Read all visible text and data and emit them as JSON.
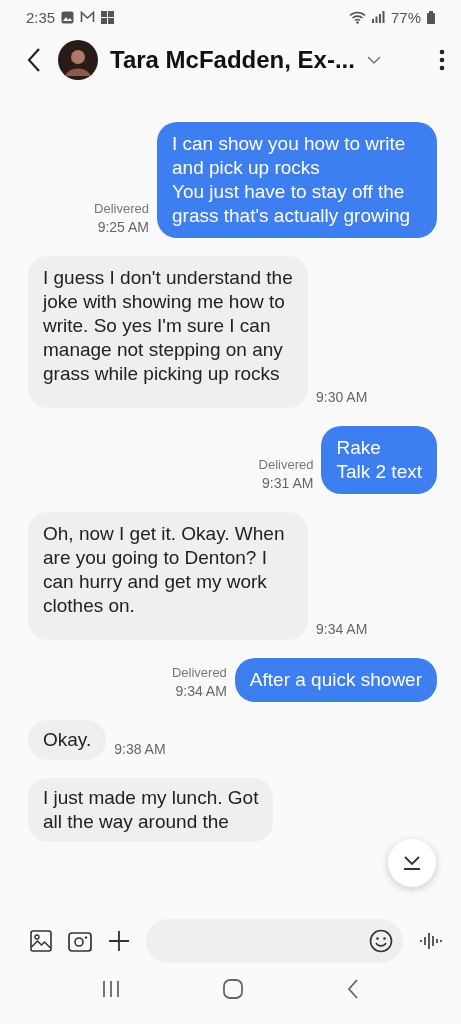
{
  "status_bar": {
    "time": "2:35",
    "battery": "77%"
  },
  "header": {
    "contact": "Tara McFadden, Ex-..."
  },
  "messages": [
    {
      "kind": "sent",
      "text": "I can show you how to write and pick up rocks\nYou just have to stay off the grass that's actually growing",
      "status": "Delivered",
      "time": "9:25 AM"
    },
    {
      "kind": "received",
      "text": "I guess I don't understand the joke with showing me how to write. So yes I'm sure I can manage not stepping on any grass while picking up rocks",
      "time": "9:30 AM"
    },
    {
      "kind": "sent",
      "text": "Rake\nTalk 2 text",
      "status": "Delivered",
      "time": "9:31 AM"
    },
    {
      "kind": "received",
      "text": "Oh, now I get it. Okay. When are you going to Denton? I can hurry and get my work clothes on.",
      "time": "9:34 AM"
    },
    {
      "kind": "sent",
      "text": "After a quick shower",
      "status": "Delivered",
      "time": "9:34 AM"
    },
    {
      "kind": "received",
      "text": "Okay.",
      "time": "9:38 AM"
    },
    {
      "kind": "received",
      "text": "I just made my lunch. Got\nall the way around the"
    }
  ]
}
